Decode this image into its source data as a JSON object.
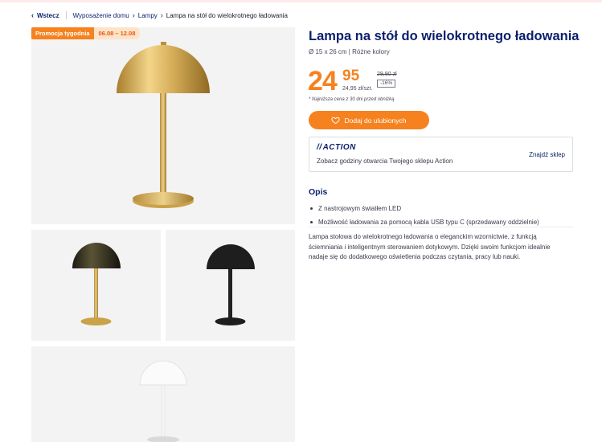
{
  "breadcrumb": {
    "back_label": "Wstecz",
    "items": [
      "Wyposażenie domu",
      "Lampy"
    ],
    "current": "Lampa na stół do wielokrotnego ładowania"
  },
  "promo": {
    "label": "Promocja tygodnia",
    "dates": "06.08 – 12.08"
  },
  "product": {
    "title": "Lampa na stół do wielokrotnego ładowania",
    "subtitle": "Ø 15 x 26 cm | Różne kolory",
    "price_integer": "24",
    "price_decimal": "95",
    "price_per_unit": "24,95 zł/szt.",
    "old_price": "29,90 zł",
    "discount": "-16%",
    "lowest_price_note": "* Najniższa cena z 30 dni przed obniżką",
    "favorite_button": "Dodaj do ulubionych"
  },
  "store": {
    "logo": "ACTION",
    "text": "Zobacz godziny otwarcia Twojego sklepu Action",
    "link": "Znajdź sklep"
  },
  "description": {
    "heading": "Opis",
    "features": [
      "Z nastrojowym światłem LED",
      "Możliwość ładowania za pomocą kabla USB typu C (sprzedawany oddzielnie)"
    ],
    "text": "Lampa stołowa do wielokrotnego ładowania o eleganckim wzornictwie, z funkcją ściemniania i inteligentnym sterowaniem dotykowym. Dzięki swoim funkcjom idealnie nadaje się do dodatkowego oświetlenia podczas czytania, pracy lub nauki."
  },
  "colors": {
    "brand_blue": "#0b1f6d",
    "accent_orange": "#f5821f",
    "gold": "#c9a24a",
    "black": "#1e1e1e",
    "white_lamp": "#f6f6f6"
  },
  "icons": {
    "back": "chevron-left-icon",
    "crumb": "chevron-right-icon",
    "favorite": "heart-icon"
  }
}
